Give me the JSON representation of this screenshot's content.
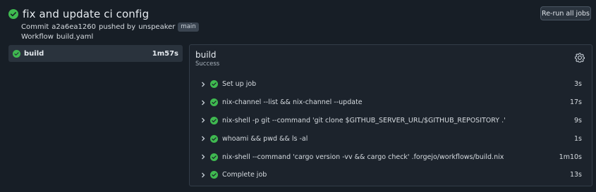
{
  "run": {
    "title": "fix and update ci config",
    "commit_prefix": "Commit",
    "commit_sha": "a2a6ea1260",
    "pushed_by_text": "pushed by",
    "author": "unspeaker",
    "branch": "main",
    "workflow_prefix": "Workflow",
    "workflow_file": "build.yaml",
    "status_icon": "success-check-icon"
  },
  "actions": {
    "rerun_label": "Re-run all jobs"
  },
  "sidebar": {
    "jobs": [
      {
        "label": "build",
        "duration": "1m57s"
      }
    ]
  },
  "job": {
    "title": "build",
    "status": "Success",
    "steps": [
      {
        "name": "Set up job",
        "duration": "3s"
      },
      {
        "name": "nix-channel --list && nix-channel --update",
        "duration": "17s"
      },
      {
        "name": "nix-shell -p git --command 'git clone $GITHUB_SERVER_URL/$GITHUB_REPOSITORY .'",
        "duration": "9s"
      },
      {
        "name": "whoami && pwd && ls -al",
        "duration": "1s"
      },
      {
        "name": "nix-shell --command 'cargo version -vv && cargo check' .forgejo/workflows/build.nix",
        "duration": "1m10s"
      },
      {
        "name": "Complete job",
        "duration": "13s"
      }
    ]
  },
  "colors": {
    "success": "#3fb950",
    "background": "#171e26",
    "panel": "#1c232c"
  }
}
